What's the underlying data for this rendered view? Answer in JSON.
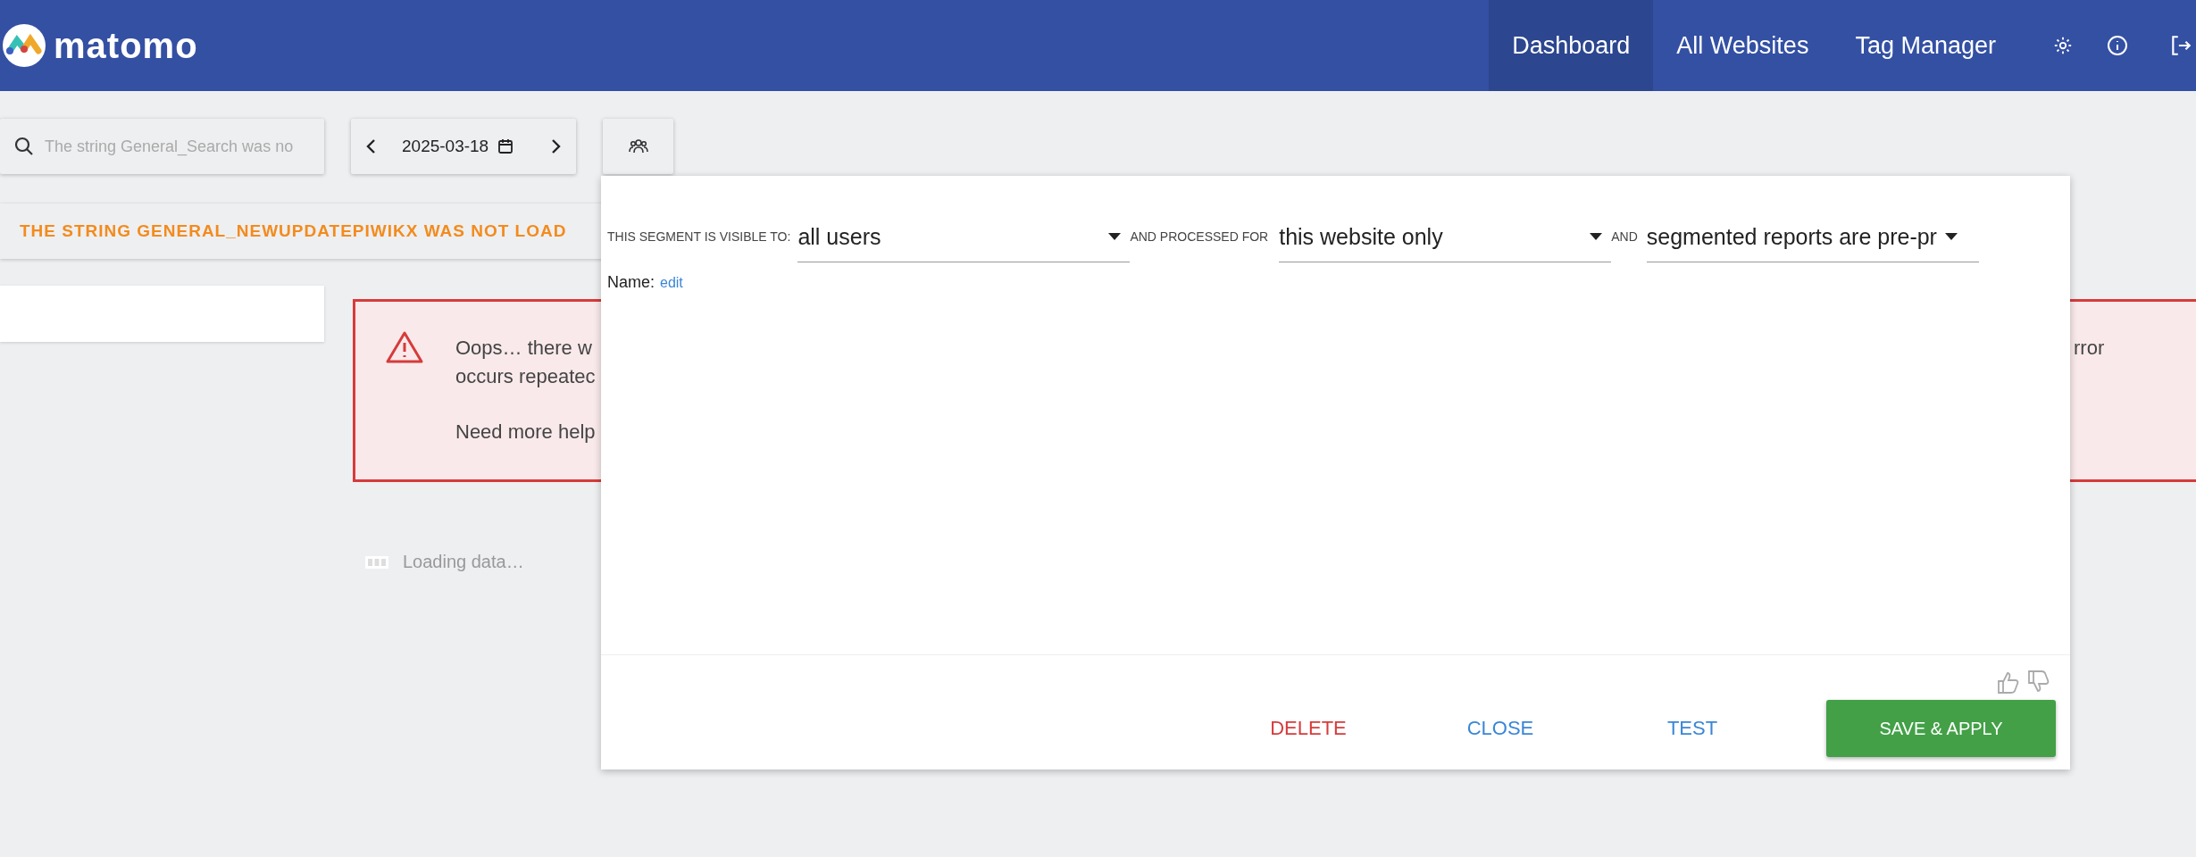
{
  "header": {
    "logo": "matomo",
    "nav": [
      {
        "label": "Dashboard",
        "selected": true
      },
      {
        "label": "All Websites",
        "selected": false
      },
      {
        "label": "Tag Manager",
        "selected": false
      }
    ]
  },
  "toolbar": {
    "search": {
      "placeholder": "The string General_Search was no"
    },
    "date": "2025-03-18"
  },
  "notification": "THE STRING GENERAL_NEWUPDATEPIWIKX WAS NOT LOAD",
  "error": {
    "lines": [
      "Oops… there w",
      "occurs repeatec"
    ],
    "help": "Need more help",
    "right_fragment": "rror"
  },
  "loading": "Loading data…",
  "segment_editor": {
    "selects": [
      {
        "label": "THIS SEGMENT IS VISIBLE TO:",
        "value": "all users"
      },
      {
        "label": "AND PROCESSED FOR",
        "value": "this website only"
      },
      {
        "label": "AND",
        "value": "segmented reports are pre-pr"
      }
    ],
    "name_label": "Name:",
    "name_link": "edit",
    "buttons": [
      {
        "label": "DELETE",
        "kind": "danger"
      },
      {
        "label": "CLOSE",
        "kind": "link"
      },
      {
        "label": "TEST",
        "kind": "link"
      },
      {
        "label": "SAVE & APPLY",
        "kind": "primary"
      }
    ]
  }
}
